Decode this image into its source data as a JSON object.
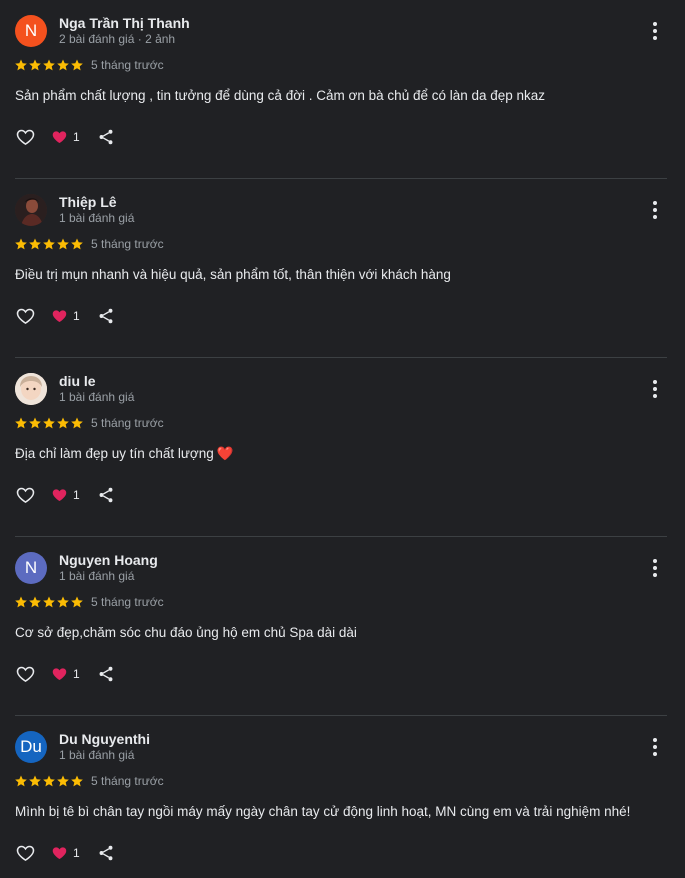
{
  "reviews": [
    {
      "avatar_letter": "N",
      "avatar_color": "#f4511e",
      "avatar_kind": "letter",
      "name": "Nga Trần Thị Thanh",
      "meta": "2 bài đánh giá · 2 ảnh",
      "stars": 5,
      "time": "5 tháng trước",
      "text": "Sản phẩm chất lượng , tin tưởng để dùng cả đời . Cảm ơn bà chủ để có làn da đẹp nkaz",
      "text_emoji": "",
      "reaction_count": "1"
    },
    {
      "avatar_letter": "",
      "avatar_color": "#3a2a2a",
      "avatar_kind": "photo-dark",
      "name": "Thiệp Lê",
      "meta": "1 bài đánh giá",
      "stars": 5,
      "time": "5 tháng trước",
      "text": "Điều trị mụn nhanh và hiệu quả, sản phẩm tốt, thân thiện với khách hàng",
      "text_emoji": "",
      "reaction_count": "1"
    },
    {
      "avatar_letter": "",
      "avatar_color": "#e8d8cc",
      "avatar_kind": "photo-light",
      "name": "diu le",
      "meta": "1 bài đánh giá",
      "stars": 5,
      "time": "5 tháng trước",
      "text": "Địa chỉ làm đẹp uy tín chất lượng",
      "text_emoji": "❤️",
      "reaction_count": "1"
    },
    {
      "avatar_letter": "N",
      "avatar_color": "#5c6bc0",
      "avatar_kind": "letter",
      "name": "Nguyen Hoang",
      "meta": "1 bài đánh giá",
      "stars": 5,
      "time": "5 tháng trước",
      "text": "Cơ sở đẹp,chăm sóc chu đáo ủng hộ em chủ Spa dài dài",
      "text_emoji": "",
      "reaction_count": "1"
    },
    {
      "avatar_letter": "Du",
      "avatar_color": "#1565c0",
      "avatar_kind": "letter",
      "name": "Du Nguyenthi",
      "meta": "1 bài đánh giá",
      "stars": 5,
      "time": "5 tháng trước",
      "text": "Mình bị tê bì chân tay ngồi máy mấy ngày chân tay cử động linh hoạt, MN cùng em và trải nghiệm nhé!",
      "text_emoji": "",
      "reaction_count": "1"
    }
  ],
  "colors": {
    "background": "#202124",
    "star": "#fbbc04",
    "heart": "#e0245e",
    "divider": "#3c4043"
  },
  "icons": {
    "like": "heart-outline-icon",
    "reaction": "red-heart-icon",
    "share": "share-icon",
    "more": "more-vert-icon",
    "star": "star-icon"
  }
}
